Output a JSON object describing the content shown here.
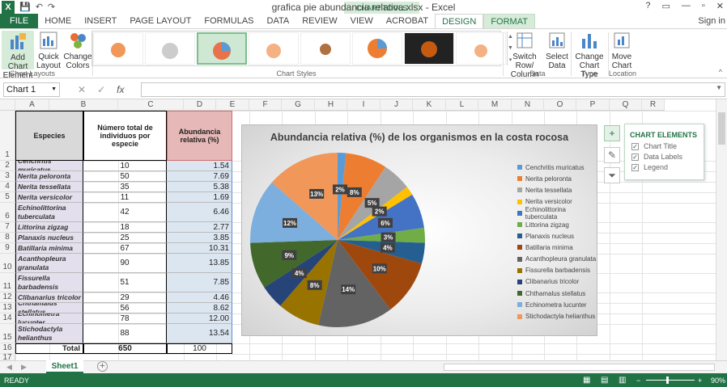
{
  "window": {
    "title": "grafica pie abundancia relativa.xlsx - Excel",
    "sign_in": "Sign in",
    "help": "?",
    "controls": [
      "▭",
      "—",
      "▫",
      "✕"
    ]
  },
  "tabs": [
    "FILE",
    "HOME",
    "INSERT",
    "PAGE LAYOUT",
    "FORMULAS",
    "DATA",
    "REVIEW",
    "VIEW",
    "ACROBAT",
    "DESIGN",
    "FORMAT"
  ],
  "context_header": "CHART TOOLS",
  "ribbon": {
    "add_chart_element": "Add Chart Element",
    "quick_layout": "Quick Layout",
    "change_colors": "Change Colors",
    "switch_row_col": "Switch Row/ Column",
    "select_data": "Select Data",
    "change_chart_type": "Change Chart Type",
    "move_chart": "Move Chart",
    "groups": {
      "layouts": "Chart Layouts",
      "styles": "Chart Styles",
      "data": "Data",
      "type": "Type",
      "location": "Location"
    }
  },
  "formula_bar": {
    "name_box": "Chart 1",
    "fx": "fx",
    "cancel": "✕",
    "enter": "✓",
    "formula": ""
  },
  "columns": [
    "A",
    "B",
    "C",
    "D",
    "E",
    "F",
    "G",
    "H",
    "I",
    "J",
    "K",
    "L",
    "M",
    "N",
    "O",
    "P",
    "Q",
    "R"
  ],
  "rows": [
    "1",
    "2",
    "3",
    "4",
    "5",
    "6",
    "7",
    "8",
    "9",
    "10",
    "11",
    "12",
    "13",
    "14",
    "15",
    "16",
    "17"
  ],
  "table": {
    "headers": [
      "Especies",
      "Número total de individuos por especie",
      "Abundancia relativa (%)"
    ],
    "rows": [
      {
        "sp": "Cenchritis muricatus",
        "n": "10",
        "pct": "1.54"
      },
      {
        "sp": "Nerita peloronta",
        "n": "50",
        "pct": "7.69"
      },
      {
        "sp": "Nerita tessellata",
        "n": "35",
        "pct": "5.38"
      },
      {
        "sp": "Nerita versicolor",
        "n": "11",
        "pct": "1.69"
      },
      {
        "sp": "Echinolittorina tuberculata",
        "n": "42",
        "pct": "6.46"
      },
      {
        "sp": "Littorina zigzag",
        "n": "18",
        "pct": "2.77"
      },
      {
        "sp": "Planaxis nucleus",
        "n": "25",
        "pct": "3.85"
      },
      {
        "sp": "Batillaria minima",
        "n": "67",
        "pct": "10.31"
      },
      {
        "sp": "Acanthopleura granulata",
        "n": "90",
        "pct": "13.85"
      },
      {
        "sp": "Fissurella barbadensis",
        "n": "51",
        "pct": "7.85"
      },
      {
        "sp": "Clibanarius tricolor",
        "n": "29",
        "pct": "4.46"
      },
      {
        "sp": "Chthamalus stellatus",
        "n": "56",
        "pct": "8.62"
      },
      {
        "sp": "Echinometra lucunter",
        "n": "78",
        "pct": "12.00"
      },
      {
        "sp": "Stichodactyla helianthus",
        "n": "88",
        "pct": "13.54"
      }
    ],
    "total_label": "Total",
    "total_n": "650",
    "total_pct": "100"
  },
  "chart_data": {
    "type": "pie",
    "title": "Abundancia relativa (%) de los organismos en la costa rocosa",
    "categories": [
      "Cenchritis muricatus",
      "Nerita peloronta",
      "Nerita tessellata",
      "Nerita versicolor",
      "Echinolittorina tuberculata",
      "Littorina zigzag",
      "Planaxis nucleus",
      "Batillaria minima",
      "Acanthopleura granulata",
      "Fissurella barbadensis",
      "Clibanarius tricolor",
      "Chthamalus stellatus",
      "Echinometra lucunter",
      "Stichodactyla helianthus"
    ],
    "values": [
      1.54,
      7.69,
      5.38,
      1.69,
      6.46,
      2.77,
      3.85,
      10.31,
      13.85,
      7.85,
      4.46,
      8.62,
      12.0,
      13.54
    ],
    "labels": [
      "2%",
      "8%",
      "5%",
      "2%",
      "6%",
      "3%",
      "4%",
      "10%",
      "14%",
      "8%",
      "4%",
      "9%",
      "12%",
      "13%"
    ],
    "colors": [
      "#5b9bd5",
      "#ed7d31",
      "#a5a5a5",
      "#ffc000",
      "#4472c4",
      "#70ad47",
      "#255e91",
      "#9e480e",
      "#636363",
      "#997300",
      "#264478",
      "#43682b",
      "#7cafdd",
      "#f1975a"
    ],
    "legend_position": "right"
  },
  "chart_elements": {
    "title": "CHART ELEMENTS",
    "items": [
      "Chart Title",
      "Data Labels",
      "Legend"
    ]
  },
  "sheet_tab": "Sheet1",
  "status": {
    "ready": "READY",
    "zoom": "90%"
  }
}
